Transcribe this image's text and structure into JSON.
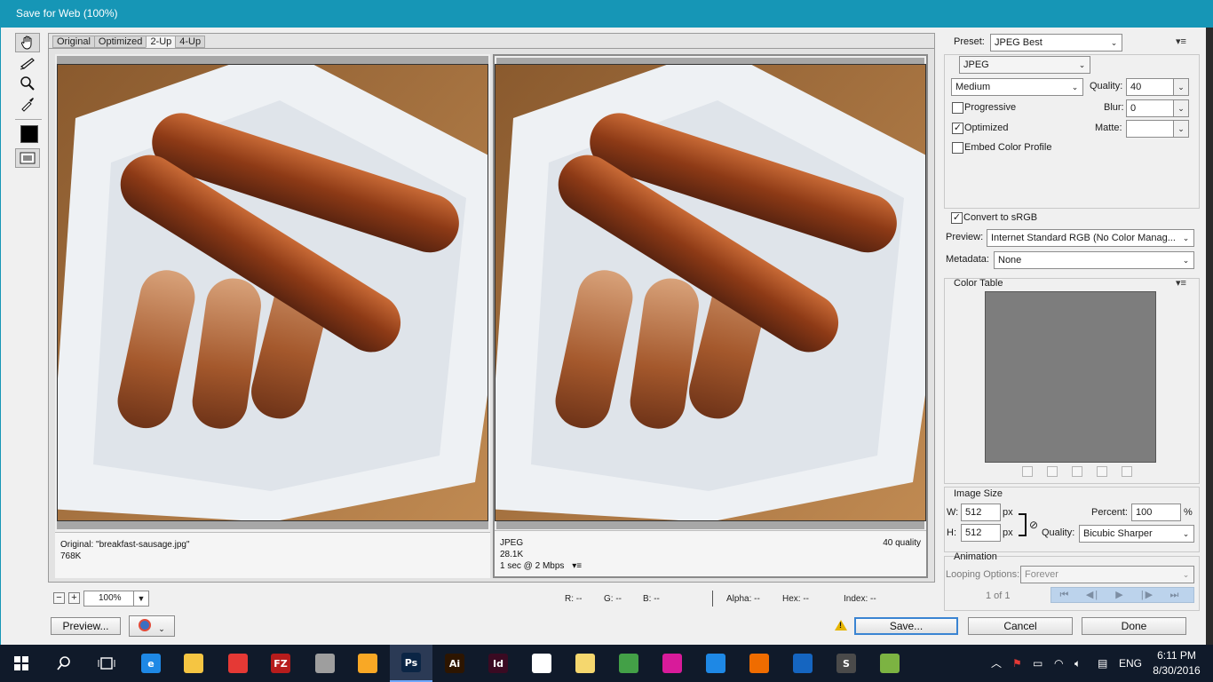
{
  "window": {
    "title": "Save for Web (100%)"
  },
  "view_tabs": [
    "Original",
    "Optimized",
    "2-Up",
    "4-Up"
  ],
  "active_view_tab": "2-Up",
  "tools": [
    "hand-tool",
    "slice-select-tool",
    "zoom-tool",
    "eyedropper-tool"
  ],
  "left_pane": {
    "line1": "Original: \"breakfast-sausage.jpg\"",
    "line2": "768K"
  },
  "right_pane": {
    "format": "JPEG",
    "size": "28.1K",
    "time": "1 sec @ 2 Mbps",
    "quality_note": "40 quality"
  },
  "zoom": {
    "minus": "−",
    "plus": "+",
    "value": "100%",
    "r": "R: --",
    "g": "G: --",
    "b": "B: --",
    "alpha": "Alpha: --",
    "hex": "Hex: --",
    "index": "Index: --"
  },
  "settings": {
    "preset_label": "Preset:",
    "preset_value": "JPEG Best",
    "format": "JPEG",
    "compression": "Medium",
    "quality_label": "Quality:",
    "quality_value": "40",
    "progressive_label": "Progressive",
    "progressive_checked": false,
    "blur_label": "Blur:",
    "blur_value": "0",
    "optimized_label": "Optimized",
    "optimized_checked": true,
    "matte_label": "Matte:",
    "matte_value": "",
    "embed_label": "Embed Color Profile",
    "embed_checked": false,
    "convert_label": "Convert to sRGB",
    "convert_checked": true,
    "preview_label": "Preview:",
    "preview_value": "Internet Standard RGB (No Color Manag...",
    "metadata_label": "Metadata:",
    "metadata_value": "None"
  },
  "color_table": {
    "title": "Color Table",
    "fill": "#7d7d7d"
  },
  "image_size": {
    "title": "Image Size",
    "w_label": "W:",
    "w_value": "512",
    "h_label": "H:",
    "h_value": "512",
    "unit": "px",
    "percent_label": "Percent:",
    "percent_value": "100",
    "percent_unit": "%",
    "quality_label": "Quality:",
    "quality_value": "Bicubic Sharper"
  },
  "animation": {
    "title": "Animation",
    "looping_label": "Looping Options:",
    "looping_value": "Forever",
    "frame_counter": "1 of 1",
    "nav": [
      "⏮",
      "◀|",
      "▶",
      "|▶",
      "⏭"
    ]
  },
  "buttons": {
    "preview": "Preview...",
    "save": "Save...",
    "cancel": "Cancel",
    "done": "Done"
  },
  "taskbar": {
    "apps": [
      {
        "name": "start-button",
        "label": "",
        "color": "#ffffff"
      },
      {
        "name": "search-icon",
        "label": "",
        "color": "#ffffff"
      },
      {
        "name": "task-view-icon",
        "label": "",
        "color": "#ffffff"
      },
      {
        "name": "edge-icon",
        "label": "e",
        "color": "#1e88e5"
      },
      {
        "name": "file-explorer-icon",
        "label": "",
        "color": "#f5c542"
      },
      {
        "name": "chrome-icon",
        "label": "",
        "color": "#e53935"
      },
      {
        "name": "filezilla-icon",
        "label": "FZ",
        "color": "#b71c1c"
      },
      {
        "name": "photo-viewer-icon",
        "label": "",
        "color": "#9e9e9e"
      },
      {
        "name": "paint-icon",
        "label": "",
        "color": "#f9a825"
      },
      {
        "name": "photoshop-icon",
        "label": "Ps",
        "color": "#0b2545"
      },
      {
        "name": "illustrator-icon",
        "label": "Ai",
        "color": "#2d1500"
      },
      {
        "name": "indesign-icon",
        "label": "Id",
        "color": "#3a0a22"
      },
      {
        "name": "sticky-notes-icon",
        "label": "",
        "color": "#ffffff"
      },
      {
        "name": "folder-icon",
        "label": "",
        "color": "#f5d76e"
      },
      {
        "name": "upload-icon",
        "label": "",
        "color": "#43a047"
      },
      {
        "name": "app-pink-icon",
        "label": "",
        "color": "#d81b9a"
      },
      {
        "name": "trello-icon",
        "label": "",
        "color": "#1e88e5"
      },
      {
        "name": "firefox-icon",
        "label": "",
        "color": "#ef6c00"
      },
      {
        "name": "thunderbird-icon",
        "label": "",
        "color": "#1565c0"
      },
      {
        "name": "sublime-icon",
        "label": "S",
        "color": "#4a4a4a"
      },
      {
        "name": "clover-icon",
        "label": "",
        "color": "#7cb342"
      }
    ],
    "active_app": "photoshop-icon",
    "lang": "ENG",
    "time": "6:11 PM",
    "date": "8/30/2016"
  }
}
